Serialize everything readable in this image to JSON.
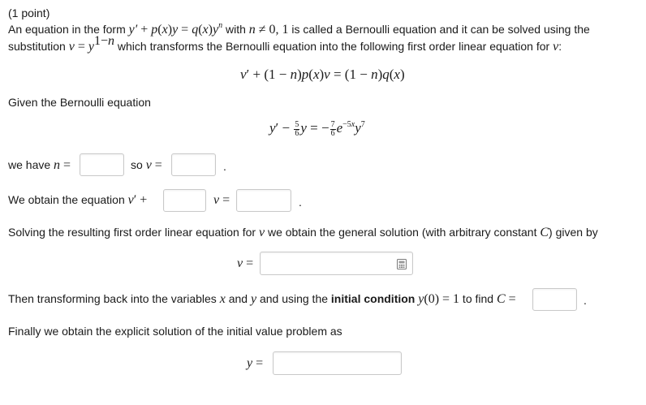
{
  "header": {
    "points": "(1 point)"
  },
  "intro": {
    "line1_text1": "An equation in the form ",
    "line1_text2": " with ",
    "line1_text3": " is called a Bernoulli equation and it can be solved using the",
    "line2_text1": "substitution ",
    "line2_text2": " which transforms the Bernoulli equation into the following first order linear equation for ",
    "line2_text3": ":"
  },
  "given": {
    "label": "Given the Bernoulli equation"
  },
  "row_n": {
    "we_have": "we have ",
    "so": "so ",
    "period": "."
  },
  "row_eq": {
    "obtain": "We obtain the equation ",
    "period": "."
  },
  "solving": {
    "text1": "Solving the resulting first order linear equation for ",
    "text2": " we obtain the general solution (with arbitrary constant ",
    "text3": ") given by"
  },
  "transform": {
    "text1": "Then transforming back into the variables ",
    "text2": " and ",
    "text3": " and using the ",
    "bold": "initial condition",
    "text4": " to find ",
    "period": "."
  },
  "finally": {
    "text": "Finally we obtain the explicit solution of the initial value problem as"
  },
  "answers": {
    "n": "",
    "v": "",
    "p": "",
    "q": "",
    "general_v": "",
    "C": "",
    "y": ""
  }
}
